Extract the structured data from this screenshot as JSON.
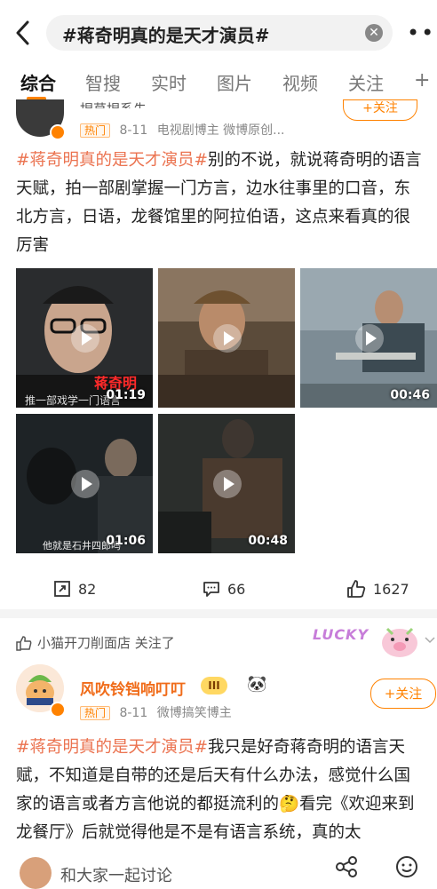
{
  "search": {
    "query": "#蒋奇明真的是天才演员#"
  },
  "tabs": [
    {
      "label": "综合"
    },
    {
      "label": "智搜"
    },
    {
      "label": "实时"
    },
    {
      "label": "图片"
    },
    {
      "label": "视频"
    },
    {
      "label": "关注"
    },
    {
      "label": "+"
    }
  ],
  "post1": {
    "author_partial": "捏草捏系先",
    "hot_badge": "热门",
    "date": "8-11",
    "source": "电视剧博主 微博原创...",
    "follow_label": "+关注",
    "topic": "#蒋奇明真的是天才演员#",
    "body": "别的不说，就说蒋奇明的语言天赋，拍一部剧掌握一门方言，边水往事里的口音，东北方言，日语，龙餐馆里的阿拉伯语，这点来看真的很厉害",
    "videos": [
      {
        "duration": "01:19",
        "overlay": "蒋奇明",
        "sub": "推一部戏学一门语言",
        "bg": "#2a2c2e"
      },
      {
        "duration": "",
        "overlay": "",
        "sub": "",
        "bg": "#5b4b3a"
      },
      {
        "duration": "00:46",
        "overlay": "",
        "sub": "",
        "bg": "#7d8c95"
      },
      {
        "duration": "01:06",
        "overlay": "",
        "sub": "他就是石井四郎吗",
        "bg": "#1e2326"
      },
      {
        "duration": "00:48",
        "overlay": "",
        "sub": "",
        "bg": "#2b2e2c"
      }
    ],
    "actions": {
      "repost": "82",
      "comment": "66",
      "like": "1627"
    }
  },
  "post2": {
    "followed_note": "小猫开刀削面店 关注了",
    "lucky": "LUCKY",
    "author": "风吹铃铛响叮叮",
    "vip_level": "III",
    "hot_badge": "热门",
    "date": "8-11",
    "source": "微博搞笑博主",
    "follow_label": "+关注",
    "topic": "#蒋奇明真的是天才演员#",
    "body": "我只是好奇蒋奇明的语言天赋，不知道是自带的还是后天有什么办法，感觉什么国家的语言或者方言他说的都挺流利的🤔看完《欢迎来到龙餐厅》后就觉得他是不是有语言系统，真的太"
  },
  "bottom": {
    "discuss_placeholder": "和大家一起讨论"
  },
  "colors": {
    "accent": "#ff8200",
    "topic": "#eb7350"
  },
  "icons": [
    "back-arrow-icon",
    "clear-icon",
    "more-icon",
    "play-icon",
    "repost-icon",
    "comment-icon",
    "like-icon",
    "emoji-icon",
    "share-icon"
  ]
}
